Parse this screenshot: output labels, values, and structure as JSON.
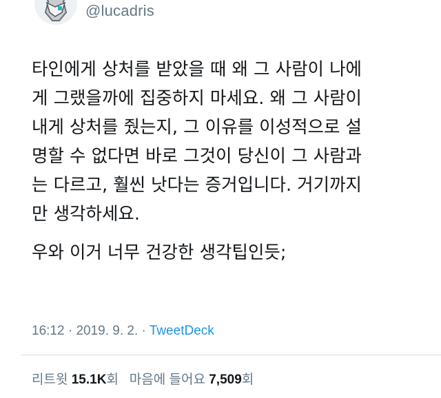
{
  "author": {
    "handle": "@lucadris",
    "avatar_icon": "robot-character-avatar"
  },
  "tweet": {
    "text_paragraph_1": "타인에게 상처를 받았을 때 왜 그 사람이 나에\n게 그랬을까에 집중하지 마세요. 왜 그 사람이\n내게 상처를 줬는지, 그 이유를 이성적으로 설\n명할 수 없다면 바로 그것이 당신이 그 사람과\n는 다르고, 훨씬 낫다는 증거입니다. 거기까지\n만 생각하세요.",
    "text_paragraph_2": "우와 이거 너무 건강한 생각팁인듯;"
  },
  "meta": {
    "time": "16:12",
    "sep1": " · ",
    "date": "2019. 9. 2.",
    "sep2": " · ",
    "source": "TweetDeck"
  },
  "stats": {
    "retweets_label": "리트윗",
    "retweets_count": "15.1K",
    "retweets_unit": "회",
    "likes_label": "마음에 들어요",
    "likes_count": "7,509",
    "likes_unit": "회"
  },
  "colors": {
    "text": "#14171a",
    "secondary": "#657786",
    "link": "#1b95e0",
    "divider": "#d6dde3"
  }
}
